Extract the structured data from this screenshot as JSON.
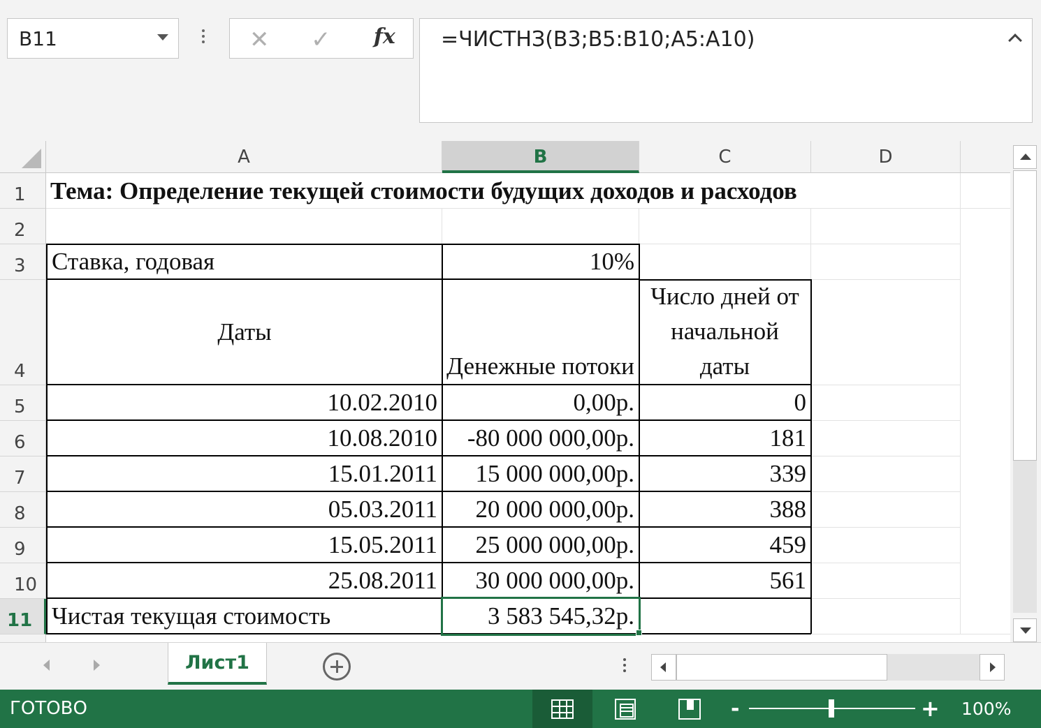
{
  "formula_bar": {
    "name_box": "B11",
    "cancel_icon": "✕",
    "enter_icon": "✓",
    "fx_label": "fx",
    "formula": "=ЧИСТНЗ(B3;B5:B10;A5:A10)"
  },
  "columns": [
    "A",
    "B",
    "C",
    "D"
  ],
  "rows": [
    "1",
    "2",
    "3",
    "4",
    "5",
    "6",
    "7",
    "8",
    "9",
    "10",
    "11"
  ],
  "cells": {
    "A1": "Тема: Определение текущей стоимости будущих доходов и расходов",
    "A3": "Ставка, годовая",
    "B3": "10%",
    "A4": "Даты",
    "B4": "Денежные потоки",
    "C4": "Число дней от начальной даты",
    "A5": "10.02.2010",
    "B5": "0,00р.",
    "C5": "0",
    "A6": "10.08.2010",
    "B6": "-80 000 000,00р.",
    "C6": "181",
    "A7": "15.01.2011",
    "B7": "15 000 000,00р.",
    "C7": "339",
    "A8": "05.03.2011",
    "B8": "20 000 000,00р.",
    "C8": "388",
    "A9": "15.05.2011",
    "B9": "25 000 000,00р.",
    "C9": "459",
    "A10": "25.08.2011",
    "B10": "30 000 000,00р.",
    "C10": "561",
    "A11": "Чистая текущая стоимость",
    "B11": "3 583 545,32р."
  },
  "sheet_tabs": {
    "active": "Лист1"
  },
  "status_bar": {
    "status": "ГОТОВО",
    "zoom_minus": "-",
    "zoom_plus": "+",
    "zoom": "100%",
    "zoom_percent": 100
  },
  "colors": {
    "accent": "#217346"
  },
  "icons": {
    "normal_view": "normal-view-icon",
    "page_layout": "page-layout-icon",
    "page_break": "page-break-preview-icon",
    "add_sheet": "plus-circle-icon"
  }
}
